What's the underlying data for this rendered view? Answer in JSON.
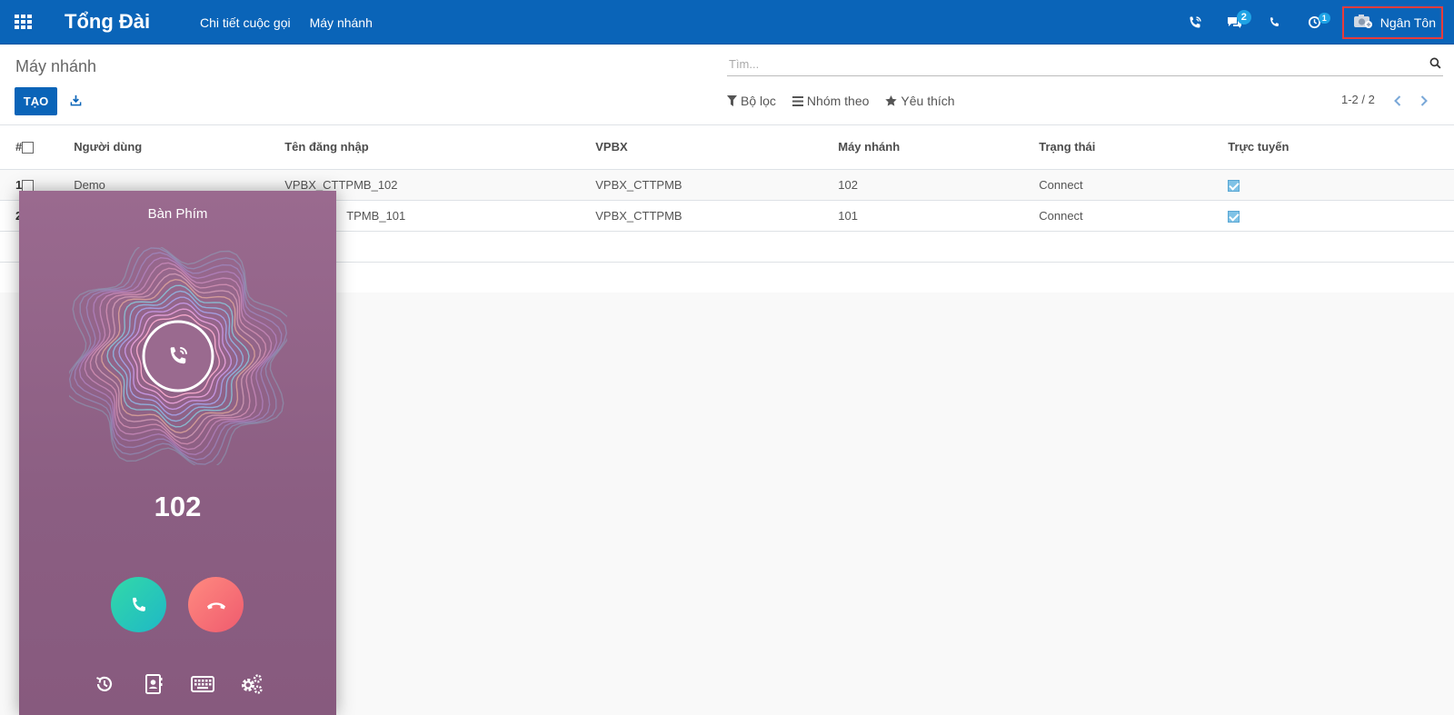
{
  "navbar": {
    "app_title": "Tổng Đài",
    "menu": [
      "Chi tiết cuộc gọi",
      "Máy nhánh"
    ],
    "messages_badge": "2",
    "activity_badge": "1",
    "user_name": "Ngân Tôn"
  },
  "control_panel": {
    "breadcrumb": "Máy nhánh",
    "search_placeholder": "Tìm...",
    "create_label": "TẠO",
    "filters_label": "Bộ lọc",
    "group_by_label": "Nhóm theo",
    "favorites_label": "Yêu thích",
    "pager": "1-2 / 2"
  },
  "table": {
    "columns": [
      "#",
      "Người dùng",
      "Tên đăng nhập",
      "VPBX",
      "Máy nhánh",
      "Trạng thái",
      "Trực tuyến"
    ],
    "rows": [
      {
        "index": "1",
        "user": "Demo",
        "login": "VPBX_CTTPMB_102",
        "vpbx": "VPBX_CTTPMB",
        "extension": "102",
        "status": "Connect",
        "online": true
      },
      {
        "index": "2",
        "user": "",
        "login": "TPMB_101",
        "vpbx": "VPBX_CTTPMB",
        "extension": "101",
        "status": "Connect",
        "online": true
      }
    ]
  },
  "dialer": {
    "title": "Bàn Phím",
    "number": "102"
  },
  "colors": {
    "navbar": "#0a64b8",
    "dialer_bg": "#8b5e82",
    "answer": "#1fb8c6",
    "hangup": "#ef5b6e"
  }
}
